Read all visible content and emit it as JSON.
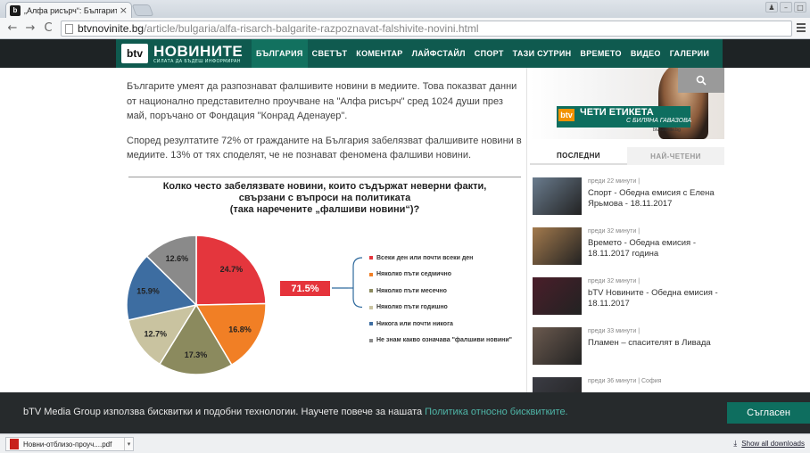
{
  "browser": {
    "tab_title": "„Алфа рисърч“: Българите",
    "url_host": "btvnovinite.bg",
    "url_path": "/article/bulgaria/alfa-risarch-balgarite-razpoznavat-falshivite-novini.html"
  },
  "site": {
    "logo_short": "btv",
    "logo_name": "НОВИНИТЕ",
    "logo_tagline": "СИЛАТА ДА БЪДЕШ ИНФОРМИРАН",
    "nav": [
      "БЪЛГАРИЯ",
      "СВЕТЪТ",
      "КОМЕНТАР",
      "ЛАЙФСТАЙЛ",
      "СПОРТ",
      "ТАЗИ СУТРИН",
      "ВРЕМЕТО",
      "ВИДЕО",
      "ГАЛЕРИИ"
    ],
    "accent": "#0f5a4f"
  },
  "article": {
    "p1": "Българите умеят да разпознават фалшивите новини в медиите. Това показват данни от национално представително проучване на \"Алфа рисърч\" сред 1024 души през май, поръчано от Фондация \"Конрад Аденауер\".",
    "p2": "Според резултатите 72% от гражданите на България забелязват фалшивите новини в медиите. 13% от тях споделят, че не познават феномена фалшиви новини."
  },
  "chart_data": {
    "type": "pie",
    "title_lines": [
      "Колко често забелязвате новини, които съдържат неверни факти,",
      "свързани с въпроси на политиката",
      "(така наречените „фалшиви новини“)?"
    ],
    "labels": [
      "Всеки ден или почти всеки ден",
      "Няколко пъти седмично",
      "Няколко пъти месечно",
      "Няколко пъти годишно",
      "Никога или почти никога",
      "Не знам какво означава \"фалшиви новини\""
    ],
    "values": [
      24.7,
      16.8,
      17.3,
      12.7,
      15.9,
      12.6
    ],
    "value_labels": [
      "24.7%",
      "16.8%",
      "17.3%",
      "12.7%",
      "15.9%",
      "12.6%"
    ],
    "colors": [
      "#e4363d",
      "#f17f25",
      "#8b8a5e",
      "#c9c3a0",
      "#3d6da1",
      "#8a8a8a"
    ],
    "summary_label": "71.5%",
    "summary_groups": 4
  },
  "sidebar": {
    "promo_title": "ЧЕТИ ЕТИКЕТА",
    "promo_sub": "С БИЛЯНА ГАВАЗОВА",
    "promo_url": "btvnovinite.bg",
    "promo_logo": "btv",
    "tab_latest": "ПОСЛЕДНИ",
    "tab_most_read": "НАЙ-ЧЕТЕНИ",
    "news": [
      {
        "meta": "преди 22 минути |",
        "title": "Спорт - Обедна емисия с Елена Ярьмова - 18.11.2017",
        "thumb": "#6a7c8e"
      },
      {
        "meta": "преди 32 минути |",
        "title": "Времето - Обедна емисия - 18.11.2017 година",
        "thumb": "#a37a4d"
      },
      {
        "meta": "преди 32 минути |",
        "title": "bTV Новините - Обедна емисия - 18.11.2017",
        "thumb": "#4a1e2a"
      },
      {
        "meta": "преди 33 минути |",
        "title": "Пламен – спасителят в Ливада",
        "thumb": "#6b5a4f"
      },
      {
        "meta": "преди 36 минути | София",
        "title": "",
        "thumb": "#3b3c44"
      }
    ]
  },
  "cookie": {
    "text": "bTV Media Group използва бисквитки и подобни технологии. Научете повече за нашата ",
    "link": "Политика относно бисквитките.",
    "accept": "Съгласен"
  },
  "downloads": {
    "file": "Новни-отблизо-проуч....pdf",
    "show_all": "Show all downloads"
  }
}
